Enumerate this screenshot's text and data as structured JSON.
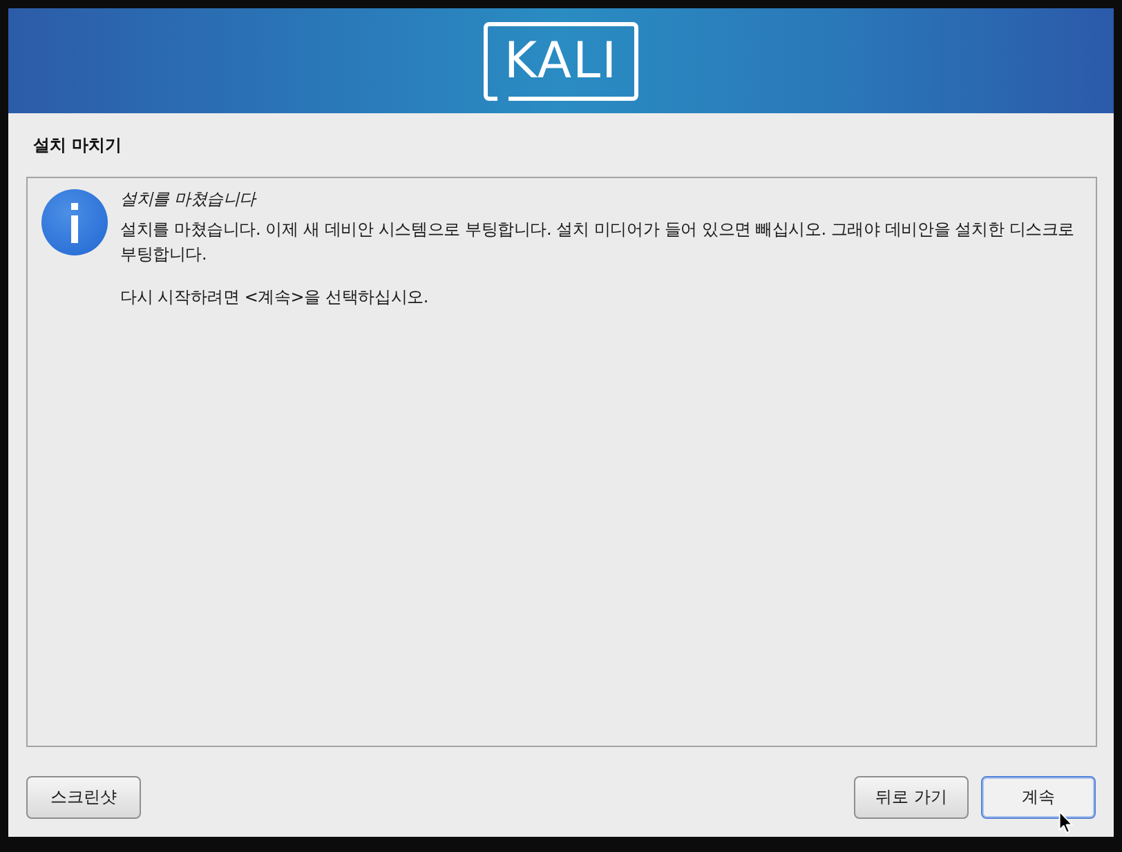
{
  "banner": {
    "logo": "KALI"
  },
  "page": {
    "title": "설치 마치기"
  },
  "message": {
    "kind": "info",
    "heading": "설치를 마쳤습니다",
    "paragraphs": [
      "설치를 마쳤습니다. 이제 새 데비안 시스템으로 부팅합니다. 설치 미디어가 들어 있으면 빼십시오. 그래야 데비안을 설치한 디스크로 부팅합니다.",
      "다시 시작하려면 <계속>을 선택하십시오."
    ]
  },
  "footer": {
    "left_buttons": [
      {
        "label": "스크린샷",
        "focused": false
      }
    ],
    "right_buttons": [
      {
        "label": "뒤로 가기",
        "focused": false
      },
      {
        "label": "계속",
        "focused": true
      }
    ]
  }
}
